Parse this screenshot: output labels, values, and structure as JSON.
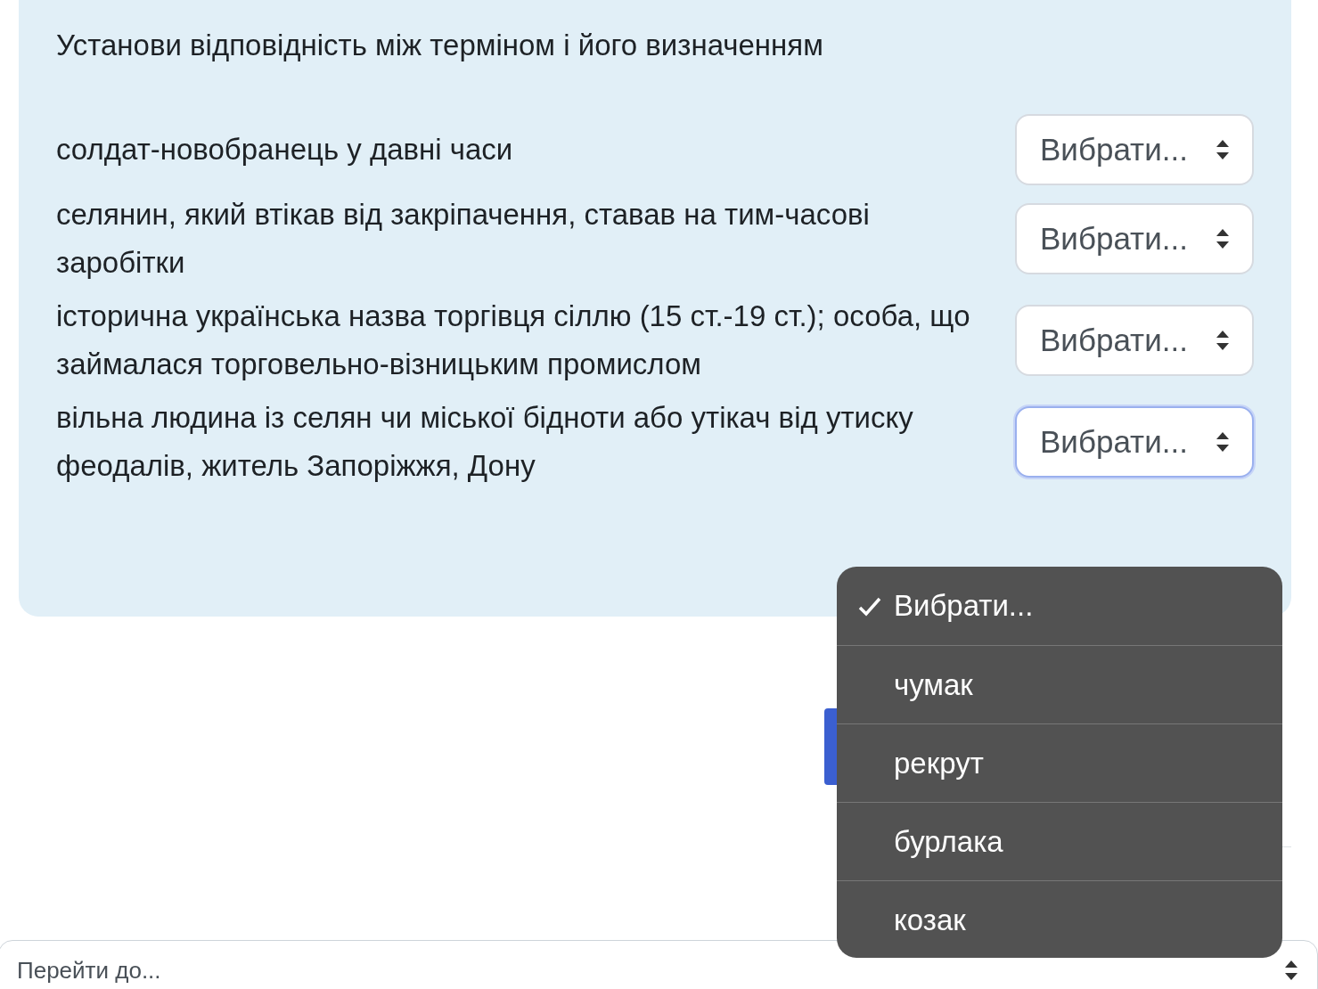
{
  "prompt": "Установи відповідність між терміном і його визначенням",
  "rows": [
    {
      "text": "солдат-новобранець у давні часи",
      "select": {
        "value": "Вибрати...",
        "focused": false
      }
    },
    {
      "text": "селянин, який втікав від закріпачення, ставав на тим-часові заробітки",
      "select": {
        "value": "Вибрати...",
        "focused": false
      }
    },
    {
      "text": "історична українська назва торгівця сіллю (15 ст.-19 ст.); особа, що займалася торговельно-візницьким промислом",
      "select": {
        "value": "Вибрати...",
        "focused": false
      }
    },
    {
      "text": "вільна людина із селян чи міської бідноти або утікач від утиску феодалів, житель Запоріжжя, Дону",
      "select": {
        "value": "Вибрати...",
        "focused": true
      }
    }
  ],
  "dropdown": {
    "options": [
      {
        "label": "Вибрати...",
        "selected": true
      },
      {
        "label": "чумак",
        "selected": false
      },
      {
        "label": "рекрут",
        "selected": false
      },
      {
        "label": "бурлака",
        "selected": false
      },
      {
        "label": "козак",
        "selected": false
      }
    ]
  },
  "jump_select": {
    "value": "Перейти до..."
  }
}
